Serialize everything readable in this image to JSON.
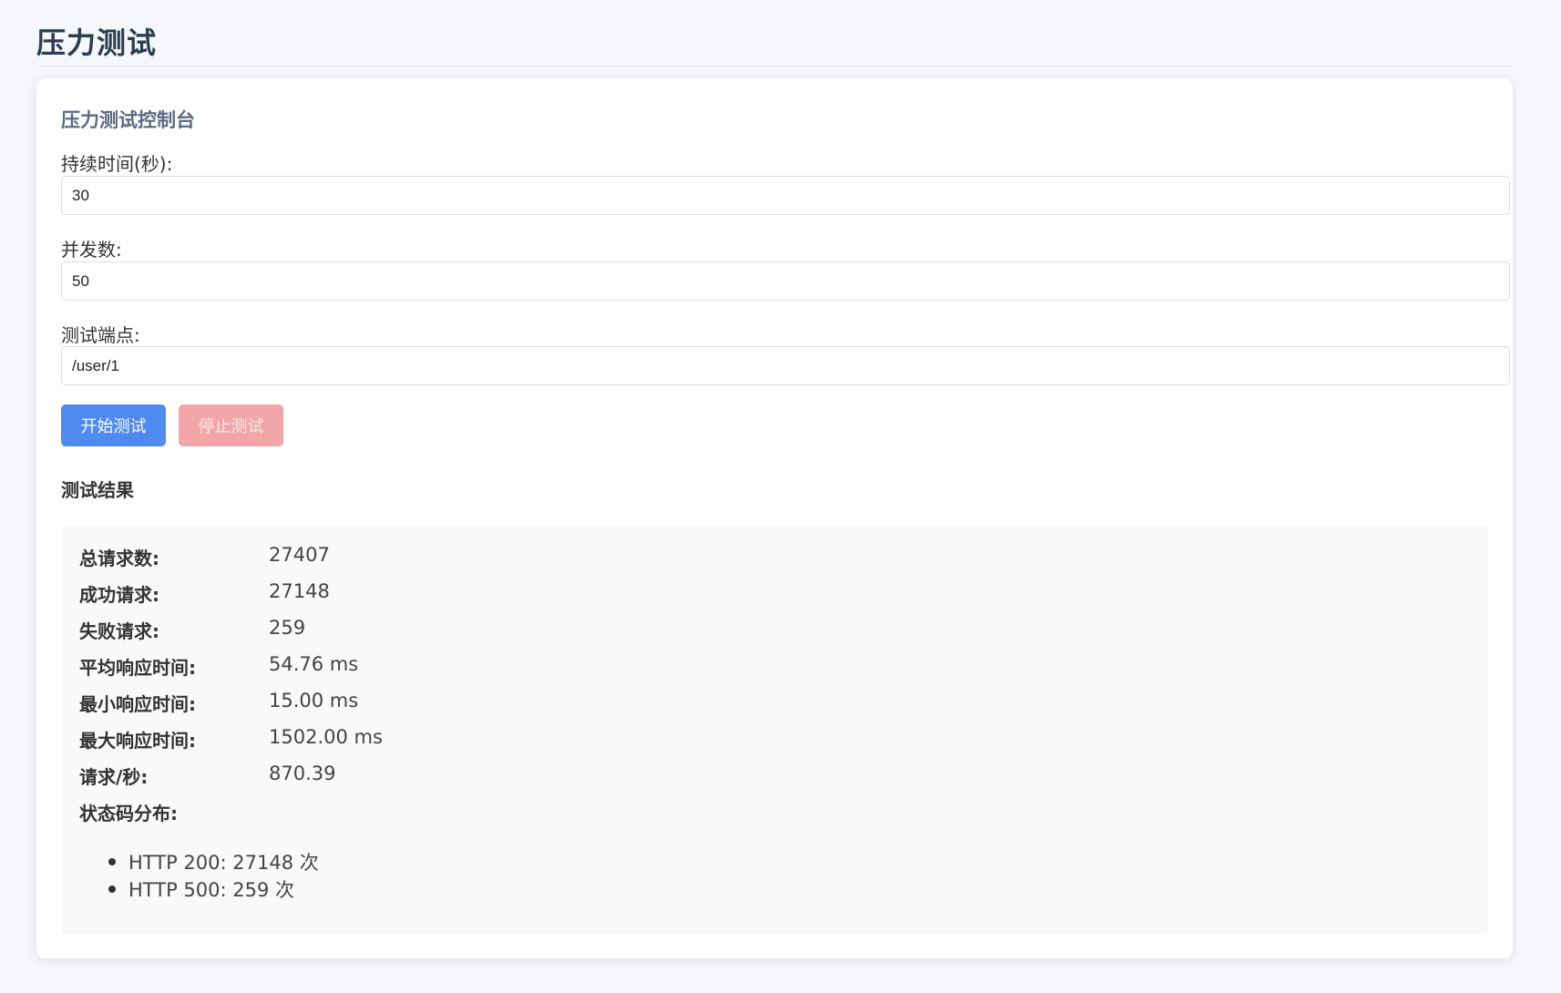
{
  "page": {
    "title": "压力测试"
  },
  "console": {
    "title": "压力测试控制台",
    "fields": [
      {
        "label": "持续时间(秒):",
        "value": "30"
      },
      {
        "label": "并发数:",
        "value": "50"
      },
      {
        "label": "测试端点:",
        "value": "/user/1"
      }
    ],
    "start_button": "开始测试",
    "stop_button": "停止测试"
  },
  "results": {
    "title": "测试结果",
    "stats": [
      {
        "label": "总请求数:",
        "value": "27407"
      },
      {
        "label": "成功请求:",
        "value": "27148"
      },
      {
        "label": "失败请求:",
        "value": "259"
      },
      {
        "label": "平均响应时间:",
        "value": "54.76 ms"
      },
      {
        "label": "最小响应时间:",
        "value": "15.00 ms"
      },
      {
        "label": "最大响应时间:",
        "value": "1502.00 ms"
      },
      {
        "label": "请求/秒:",
        "value": "870.39"
      }
    ],
    "status_title": "状态码分布:",
    "status_items": [
      "HTTP 200: 27148 次",
      "HTTP 500: 259 次"
    ]
  },
  "colors": {
    "primary": "#4e8af0",
    "danger_disabled": "#f3a6a8",
    "title_text": "#2c3e50",
    "background": "#f5f7fa"
  }
}
